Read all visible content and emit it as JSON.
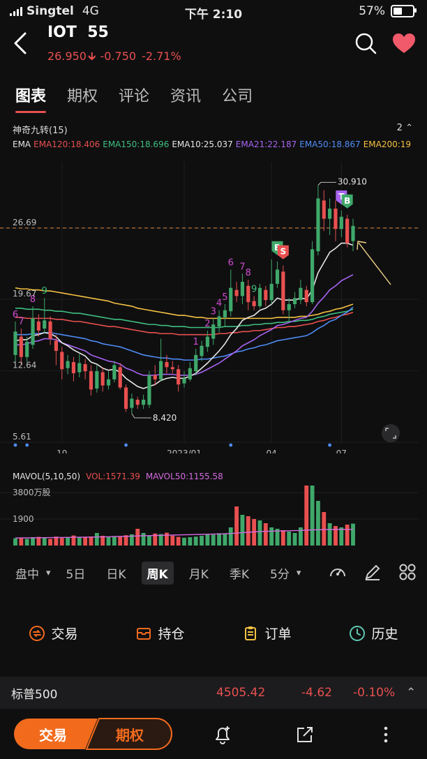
{
  "status_bar": {
    "carrier": "Singtel",
    "network": "4G",
    "time": "下午 2:10",
    "battery": "57%"
  },
  "header": {
    "ticker": "IOT",
    "count": "55",
    "price": "26.950",
    "change": "-0.750",
    "change_pct": "-2.71%"
  },
  "tabs": [
    "图表",
    "期权",
    "评论",
    "资讯",
    "公司"
  ],
  "indicator": {
    "title": "神奇九转(15)",
    "count": "2"
  },
  "ema_legend": [
    {
      "label": "EMA",
      "color": "#e6e6e6"
    },
    {
      "label": "EMA120:18.406",
      "color": "#e8504f"
    },
    {
      "label": "EMA150:18.696",
      "color": "#3fbf7f"
    },
    {
      "label": "EMA10:25.037",
      "color": "#e6e6e6"
    },
    {
      "label": "EMA21:22.187",
      "color": "#a864f0"
    },
    {
      "label": "EMA50:18.867",
      "color": "#4f8cf5"
    },
    {
      "label": "EMA200:19.17",
      "color": "#f5c242"
    }
  ],
  "chart_data": {
    "type": "candlestick",
    "y_labels": [
      "26.69",
      "19.67",
      "12.64",
      "5.61"
    ],
    "x_labels": [
      "10",
      "2023/01",
      "04",
      "07"
    ],
    "high_label": "30.910",
    "low_label": "8.420",
    "current_price_line": 26.69,
    "candles": [
      {
        "o": 14.2,
        "c": 16.5,
        "h": 17.5,
        "l": 13.0
      },
      {
        "o": 16.0,
        "c": 14.0,
        "h": 16.8,
        "l": 13.2
      },
      {
        "o": 14.0,
        "c": 15.5,
        "h": 16.0,
        "l": 13.5
      },
      {
        "o": 15.2,
        "c": 17.8,
        "h": 19.0,
        "l": 14.8
      },
      {
        "o": 17.5,
        "c": 16.6,
        "h": 18.2,
        "l": 16.0
      },
      {
        "o": 16.8,
        "c": 17.6,
        "h": 19.8,
        "l": 16.3
      },
      {
        "o": 17.5,
        "c": 15.8,
        "h": 18.0,
        "l": 15.2
      },
      {
        "o": 15.6,
        "c": 14.6,
        "h": 16.2,
        "l": 13.2
      },
      {
        "o": 14.5,
        "c": 12.8,
        "h": 15.0,
        "l": 11.8
      },
      {
        "o": 12.9,
        "c": 13.6,
        "h": 14.2,
        "l": 12.3
      },
      {
        "o": 13.5,
        "c": 12.4,
        "h": 14.0,
        "l": 11.6
      },
      {
        "o": 12.5,
        "c": 13.4,
        "h": 14.3,
        "l": 12.0
      },
      {
        "o": 13.3,
        "c": 12.6,
        "h": 13.8,
        "l": 11.8
      },
      {
        "o": 12.6,
        "c": 10.8,
        "h": 13.2,
        "l": 10.2
      },
      {
        "o": 10.9,
        "c": 12.6,
        "h": 13.2,
        "l": 10.5
      },
      {
        "o": 12.5,
        "c": 11.2,
        "h": 13.0,
        "l": 10.6
      },
      {
        "o": 11.2,
        "c": 11.8,
        "h": 12.6,
        "l": 10.8
      },
      {
        "o": 11.8,
        "c": 13.2,
        "h": 13.6,
        "l": 11.5
      },
      {
        "o": 13.0,
        "c": 11.0,
        "h": 13.4,
        "l": 10.8
      },
      {
        "o": 11.0,
        "c": 8.9,
        "h": 11.3,
        "l": 8.6
      },
      {
        "o": 9.0,
        "c": 9.9,
        "h": 10.4,
        "l": 8.42
      },
      {
        "o": 9.8,
        "c": 9.3,
        "h": 10.1,
        "l": 8.9
      },
      {
        "o": 9.3,
        "c": 9.8,
        "h": 10.3,
        "l": 8.9
      },
      {
        "o": 9.3,
        "c": 12.2,
        "h": 12.6,
        "l": 9.0
      },
      {
        "o": 12.2,
        "c": 11.8,
        "h": 13.2,
        "l": 11.2
      },
      {
        "o": 11.8,
        "c": 13.6,
        "h": 15.8,
        "l": 11.6
      },
      {
        "o": 13.5,
        "c": 13.0,
        "h": 14.2,
        "l": 12.4
      },
      {
        "o": 13.0,
        "c": 12.8,
        "h": 13.6,
        "l": 12.4
      },
      {
        "o": 12.8,
        "c": 11.3,
        "h": 13.2,
        "l": 10.6
      },
      {
        "o": 11.4,
        "c": 11.9,
        "h": 12.6,
        "l": 11.0
      },
      {
        "o": 11.8,
        "c": 12.9,
        "h": 13.5,
        "l": 11.6
      },
      {
        "o": 12.6,
        "c": 14.2,
        "h": 14.8,
        "l": 12.2
      },
      {
        "o": 14.1,
        "c": 15.1,
        "h": 15.6,
        "l": 13.6
      },
      {
        "o": 15.0,
        "c": 16.0,
        "h": 16.6,
        "l": 14.5
      },
      {
        "o": 15.8,
        "c": 17.2,
        "h": 17.8,
        "l": 15.2
      },
      {
        "o": 17.0,
        "c": 18.0,
        "h": 18.6,
        "l": 16.4
      },
      {
        "o": 17.9,
        "c": 18.6,
        "h": 19.2,
        "l": 17.0
      },
      {
        "o": 18.5,
        "c": 20.8,
        "h": 22.6,
        "l": 18.0
      },
      {
        "o": 20.6,
        "c": 20.0,
        "h": 21.4,
        "l": 19.4
      },
      {
        "o": 20.0,
        "c": 21.4,
        "h": 22.2,
        "l": 19.2
      },
      {
        "o": 21.0,
        "c": 19.4,
        "h": 21.6,
        "l": 18.6
      },
      {
        "o": 19.5,
        "c": 19.0,
        "h": 20.0,
        "l": 18.6
      },
      {
        "o": 19.0,
        "c": 20.8,
        "h": 21.2,
        "l": 18.8
      },
      {
        "o": 20.6,
        "c": 19.6,
        "h": 21.0,
        "l": 19.0
      },
      {
        "o": 19.6,
        "c": 21.2,
        "h": 23.6,
        "l": 19.2
      },
      {
        "o": 21.2,
        "c": 22.6,
        "h": 23.4,
        "l": 20.8
      },
      {
        "o": 22.4,
        "c": 18.6,
        "h": 23.0,
        "l": 18.2
      },
      {
        "o": 18.6,
        "c": 19.2,
        "h": 19.8,
        "l": 17.4
      },
      {
        "o": 19.2,
        "c": 19.8,
        "h": 20.4,
        "l": 18.8
      },
      {
        "o": 19.6,
        "c": 20.8,
        "h": 21.6,
        "l": 19.2
      },
      {
        "o": 20.6,
        "c": 19.4,
        "h": 21.0,
        "l": 19.0
      },
      {
        "o": 19.4,
        "c": 24.6,
        "h": 25.4,
        "l": 19.2
      },
      {
        "o": 24.4,
        "c": 29.6,
        "h": 30.91,
        "l": 24.0
      },
      {
        "o": 29.4,
        "c": 27.6,
        "h": 30.4,
        "l": 26.4
      },
      {
        "o": 27.6,
        "c": 28.6,
        "h": 29.6,
        "l": 26.0
      },
      {
        "o": 28.6,
        "c": 26.6,
        "h": 29.4,
        "l": 25.4
      },
      {
        "o": 26.6,
        "c": 27.8,
        "h": 28.4,
        "l": 25.8
      },
      {
        "o": 27.6,
        "c": 25.2,
        "h": 28.0,
        "l": 24.8
      },
      {
        "o": 25.4,
        "c": 26.9,
        "h": 27.6,
        "l": 24.4
      }
    ],
    "ema10": [
      15.6,
      15.7,
      15.7,
      16.1,
      16.2,
      16.4,
      16.3,
      16.0,
      15.4,
      15.1,
      14.7,
      14.4,
      14.1,
      13.5,
      13.3,
      12.9,
      12.7,
      12.8,
      12.5,
      11.9,
      11.5,
      11.1,
      10.9,
      11.1,
      11.3,
      11.7,
      11.9,
      12.0,
      11.9,
      11.9,
      12.1,
      12.4,
      12.9,
      13.4,
      14.0,
      14.6,
      15.3,
      16.2,
      16.8,
      17.6,
      17.9,
      18.1,
      18.6,
      18.8,
      19.2,
      19.8,
      19.6,
      19.6,
      19.6,
      19.8,
      19.7,
      20.6,
      22.3,
      23.3,
      24.3,
      24.7,
      25.2,
      25.2,
      25.0
    ],
    "ema21": [
      15.2,
      15.2,
      15.3,
      15.5,
      15.6,
      15.8,
      15.8,
      15.7,
      15.4,
      15.2,
      15.0,
      14.8,
      14.6,
      14.2,
      14.0,
      13.8,
      13.6,
      13.5,
      13.3,
      12.9,
      12.7,
      12.4,
      12.2,
      12.2,
      12.2,
      12.3,
      12.3,
      12.3,
      12.2,
      12.2,
      12.2,
      12.3,
      12.5,
      12.8,
      13.1,
      13.4,
      13.8,
      14.2,
      14.6,
      15.1,
      15.4,
      15.7,
      16.1,
      16.4,
      16.7,
      17.1,
      17.2,
      17.4,
      17.6,
      17.8,
      17.9,
      18.5,
      19.3,
      19.9,
      20.6,
      21.0,
      21.5,
      21.8,
      22.1
    ],
    "ema50": [
      16.2,
      16.2,
      16.2,
      16.3,
      16.3,
      16.4,
      16.4,
      16.3,
      16.2,
      16.1,
      16.0,
      15.9,
      15.8,
      15.6,
      15.5,
      15.3,
      15.2,
      15.1,
      15.0,
      14.8,
      14.6,
      14.4,
      14.2,
      14.1,
      14.0,
      13.9,
      13.9,
      13.8,
      13.8,
      13.7,
      13.7,
      13.7,
      13.8,
      13.8,
      13.9,
      14.0,
      14.1,
      14.3,
      14.5,
      14.6,
      14.8,
      14.9,
      15.1,
      15.2,
      15.4,
      15.6,
      15.7,
      15.8,
      15.9,
      16.0,
      16.1,
      16.4,
      16.8,
      17.1,
      17.5,
      17.7,
      18.1,
      18.4,
      18.9
    ],
    "ema120": [
      17.9,
      17.9,
      17.8,
      17.8,
      17.8,
      17.8,
      17.8,
      17.7,
      17.7,
      17.6,
      17.5,
      17.5,
      17.4,
      17.3,
      17.2,
      17.1,
      17.0,
      17.0,
      16.9,
      16.8,
      16.7,
      16.6,
      16.5,
      16.4,
      16.4,
      16.3,
      16.3,
      16.3,
      16.2,
      16.2,
      16.2,
      16.2,
      16.2,
      16.2,
      16.2,
      16.3,
      16.3,
      16.4,
      16.4,
      16.5,
      16.5,
      16.6,
      16.6,
      16.7,
      16.8,
      16.9,
      16.9,
      17.0,
      17.0,
      17.1,
      17.2,
      17.3,
      17.5,
      17.6,
      17.8,
      17.9,
      18.1,
      18.2,
      18.4
    ],
    "ema150": [
      18.8,
      18.8,
      18.7,
      18.7,
      18.7,
      18.6,
      18.6,
      18.5,
      18.5,
      18.4,
      18.3,
      18.3,
      18.2,
      18.1,
      18.0,
      17.9,
      17.8,
      17.7,
      17.7,
      17.6,
      17.5,
      17.4,
      17.3,
      17.2,
      17.2,
      17.1,
      17.1,
      17.0,
      17.0,
      17.0,
      16.9,
      16.9,
      16.9,
      16.9,
      16.9,
      16.9,
      17.0,
      17.0,
      17.0,
      17.1,
      17.1,
      17.2,
      17.2,
      17.3,
      17.3,
      17.4,
      17.4,
      17.5,
      17.5,
      17.6,
      17.6,
      17.7,
      17.9,
      18.0,
      18.2,
      18.3,
      18.4,
      18.5,
      18.7
    ],
    "ema200": [
      20.8,
      20.7,
      20.7,
      20.6,
      20.6,
      20.5,
      20.5,
      20.4,
      20.3,
      20.2,
      20.1,
      20.0,
      19.9,
      19.8,
      19.7,
      19.6,
      19.5,
      19.3,
      19.2,
      19.1,
      19.0,
      18.8,
      18.7,
      18.6,
      18.5,
      18.4,
      18.3,
      18.2,
      18.1,
      18.1,
      18.0,
      17.9,
      17.9,
      17.8,
      17.8,
      17.8,
      17.8,
      17.8,
      17.8,
      17.8,
      17.8,
      17.8,
      17.8,
      17.8,
      17.8,
      17.9,
      17.9,
      17.9,
      17.9,
      18.0,
      18.0,
      18.1,
      18.2,
      18.4,
      18.5,
      18.7,
      18.8,
      19.0,
      19.2
    ],
    "td_labels": [
      {
        "i": 0,
        "text": "6",
        "pos": "above"
      },
      {
        "i": 1,
        "text": "7",
        "pos": "above"
      },
      {
        "i": 3,
        "text": "8",
        "pos": "above"
      },
      {
        "i": 5,
        "text": "9",
        "pos": "above",
        "color": "#3fbf7f"
      },
      {
        "i": 31,
        "text": "1",
        "pos": "above"
      },
      {
        "i": 33,
        "text": "2",
        "pos": "above"
      },
      {
        "i": 34,
        "text": "3",
        "pos": "above"
      },
      {
        "i": 35,
        "text": "4",
        "pos": "above"
      },
      {
        "i": 36,
        "text": "5",
        "pos": "above"
      },
      {
        "i": 37,
        "text": "6",
        "pos": "above"
      },
      {
        "i": 39,
        "text": "7",
        "pos": "above"
      },
      {
        "i": 40,
        "text": "8",
        "pos": "above"
      },
      {
        "i": 41,
        "text": "9",
        "pos": "above",
        "color": "#3fbf7f"
      }
    ],
    "markers": [
      {
        "i": 45,
        "text": "B",
        "color": "#3fa86a"
      },
      {
        "i": 46,
        "text": "S",
        "color": "#e8504f"
      },
      {
        "i": 56,
        "text": "T",
        "color": "#a864f0"
      },
      {
        "i": 57,
        "text": "B",
        "color": "#3fa86a"
      }
    ],
    "ylim": [
      5.61,
      33.2
    ],
    "x_label_index": [
      8,
      29,
      44,
      56
    ]
  },
  "volume": {
    "legend": [
      {
        "label": "MAVOL(5,10,50)",
        "color": "#e6e6e6"
      },
      {
        "label": "VOL:1571.39",
        "color": "#e8504f"
      },
      {
        "label": "MAVOL50:1155.58",
        "color": "#d46be0"
      }
    ],
    "y_labels": [
      "3800万股",
      "1900"
    ],
    "bars": [
      520,
      560,
      480,
      600,
      620,
      560,
      480,
      640,
      540,
      600,
      720,
      580,
      620,
      650,
      900,
      700,
      600,
      680,
      640,
      740,
      800,
      1200,
      900,
      720,
      860,
      820,
      920,
      700,
      620,
      560,
      600,
      640,
      700,
      820,
      780,
      880,
      880,
      1300,
      2800,
      2200,
      2100,
      1900,
      1800,
      1600,
      1300,
      1200,
      1100,
      1000,
      900,
      1300,
      4300,
      4300,
      3200,
      2400,
      1600,
      1400,
      1300,
      1500,
      1571
    ],
    "mavol50": [
      540,
      545,
      550,
      555,
      560,
      565,
      570,
      575,
      580,
      585,
      590,
      595,
      600,
      605,
      610,
      620,
      630,
      640,
      650,
      660,
      670,
      690,
      700,
      710,
      720,
      730,
      740,
      750,
      760,
      770,
      780,
      790,
      800,
      810,
      820,
      830,
      840,
      860,
      890,
      920,
      950,
      980,
      1000,
      1020,
      1030,
      1040,
      1050,
      1060,
      1070,
      1080,
      1100,
      1120,
      1130,
      1140,
      1145,
      1150,
      1152,
      1154,
      1155.58
    ]
  },
  "periods": [
    "盘中",
    "5日",
    "日K",
    "周K",
    "月K",
    "季K",
    "5分"
  ],
  "active_period": "周K",
  "actions": [
    "交易",
    "持仓",
    "订单",
    "历史"
  ],
  "index_row": {
    "name": "标普500",
    "value": "4505.42",
    "change": "-4.62",
    "change_pct": "-0.10%"
  },
  "bottom": {
    "trade": "交易",
    "options": "期权"
  },
  "colors": {
    "up": "#3fa86a",
    "down": "#e8504f",
    "accent": "#e8504f",
    "orange": "#f26b1d"
  }
}
